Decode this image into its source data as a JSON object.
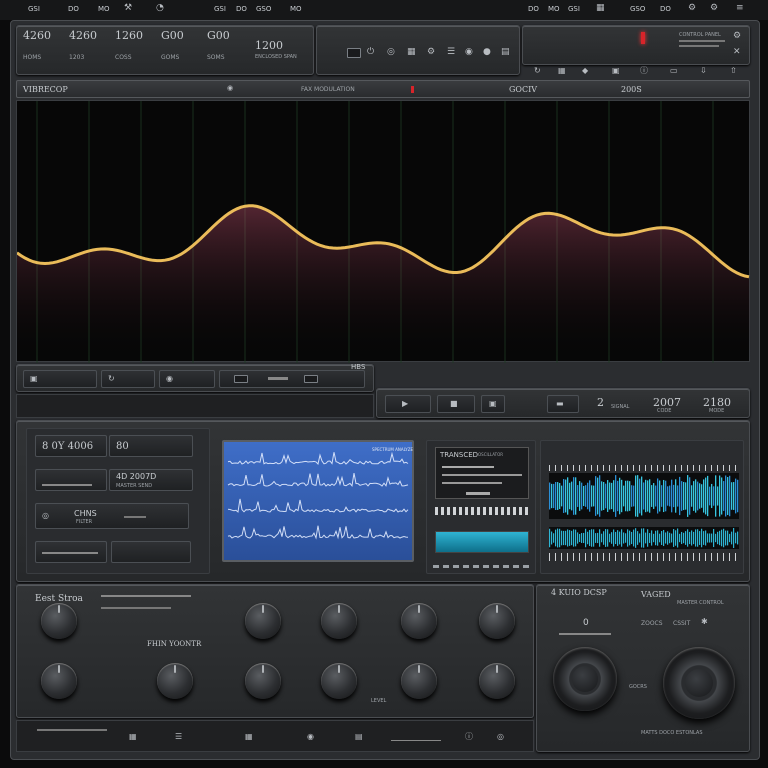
{
  "header": {
    "top_labels": [
      "GSI",
      "DO",
      "MO",
      "GSO"
    ],
    "left_readouts": [
      {
        "value": "4260",
        "label": "HOMS"
      },
      {
        "value": "4260",
        "label": "1203"
      },
      {
        "value": "1260",
        "label": "COSS"
      },
      {
        "value": "G00",
        "label": "GOMS"
      },
      {
        "value": "G00",
        "label": "SOMS"
      }
    ],
    "center_value": "1200",
    "center_caption": "ENCLOSED SPAN",
    "right_text": "CONTROL PANEL"
  },
  "waveform": {
    "left_title": "VIBRECOP",
    "center_title": "FAX MODULATION",
    "right_title": "GOCIV",
    "right_value": "200S",
    "bottom_right_label": "HBS",
    "readout_a": "2",
    "readout_b": "2007",
    "readout_c": "2180",
    "readout_a_cap": "SIGNAL",
    "readout_b_cap": "CODE",
    "readout_c_cap": "MODE"
  },
  "left_module": {
    "display_1": "8 0Y 4006",
    "display_2": "80",
    "field_1": "4D 2007D",
    "field_1_caption": "MASTER SEND",
    "field_2": "CHNS",
    "field_2_caption": "FILTER"
  },
  "center_module": {
    "screen_label": "SPECTRUM ANALYZE",
    "title": "TRANSCED",
    "sub": "OSCILLATOR"
  },
  "bottom_left": {
    "title": "Eest Stroa",
    "label": "FHIN YOONTR",
    "scale_label": "LEVEL"
  },
  "bottom_right": {
    "title": "4 KUIO DCSP",
    "sub": "VAGED",
    "zero": "0",
    "mid_label": "ZOOCS",
    "cost": "CSSIT",
    "icon": "✱",
    "caption": "MASTER CONTROL",
    "knob_caption": "GOCRS",
    "footer": "MATTS DOCO ESTONLAS"
  },
  "colors": {
    "accent_red": "#d8242a",
    "wave_yellow": "#f0c15c",
    "wave_pink": "#e15e82",
    "wave_green": "#8fd08a",
    "screen_blue": "#3a6fd1",
    "meter_cyan": "#37c6e0"
  }
}
